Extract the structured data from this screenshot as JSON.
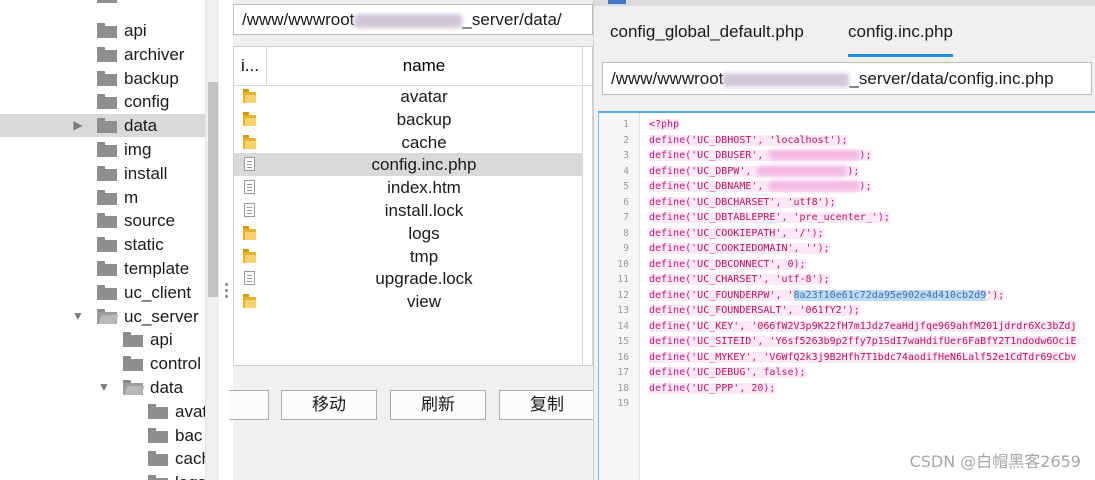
{
  "tree": {
    "items": [
      {
        "label": "api",
        "open": false,
        "arrow": ""
      },
      {
        "label": "archiver",
        "open": false,
        "arrow": ""
      },
      {
        "label": "backup",
        "open": false,
        "arrow": ""
      },
      {
        "label": "config",
        "open": false,
        "arrow": ""
      },
      {
        "label": "data",
        "open": false,
        "arrow": "▶",
        "selected": true
      },
      {
        "label": "img",
        "open": false,
        "arrow": ""
      },
      {
        "label": "install",
        "open": false,
        "arrow": ""
      },
      {
        "label": "m",
        "open": false,
        "arrow": ""
      },
      {
        "label": "source",
        "open": false,
        "arrow": ""
      },
      {
        "label": "static",
        "open": false,
        "arrow": ""
      },
      {
        "label": "template",
        "open": false,
        "arrow": ""
      },
      {
        "label": "uc_client",
        "open": false,
        "arrow": ""
      },
      {
        "label": "uc_server",
        "open": true,
        "arrow": "▼"
      }
    ],
    "uc_server_children": [
      {
        "label": "api"
      },
      {
        "label": "control"
      },
      {
        "label": "data",
        "open": true,
        "arrow": "▼"
      }
    ],
    "data_children": [
      {
        "label": "avat"
      },
      {
        "label": "bac"
      },
      {
        "label": "cach"
      },
      {
        "label": "logs"
      }
    ]
  },
  "mid": {
    "path_prefix": "/www/wwwroot",
    "path_suffix": "_server/data/",
    "columns": [
      "i...",
      "name"
    ],
    "files": [
      {
        "name": "avatar",
        "type": "folder"
      },
      {
        "name": "backup",
        "type": "folder"
      },
      {
        "name": "cache",
        "type": "folder"
      },
      {
        "name": "config.inc.php",
        "type": "file",
        "selected": true
      },
      {
        "name": "index.htm",
        "type": "file"
      },
      {
        "name": "install.lock",
        "type": "file"
      },
      {
        "name": "logs",
        "type": "folder"
      },
      {
        "name": "tmp",
        "type": "folder"
      },
      {
        "name": "upgrade.lock",
        "type": "file"
      },
      {
        "name": "view",
        "type": "folder"
      }
    ],
    "buttons": [
      "移动",
      "刷新",
      "复制"
    ]
  },
  "editor": {
    "tabs": [
      "config_global_default.php",
      "config.inc.php"
    ],
    "active_tab": 1,
    "path_prefix": "/www/wwwroot",
    "path_suffix": "_server/data/config.inc.php",
    "lines": [
      {
        "n": "1",
        "code": "<?php"
      },
      {
        "n": "2",
        "key": "UC_DBHOST",
        "val": "'localhost'"
      },
      {
        "n": "3",
        "key": "UC_DBUSER",
        "val": "",
        "redacted": true
      },
      {
        "n": "4",
        "key": "UC_DBPW",
        "val": "",
        "redacted": true
      },
      {
        "n": "5",
        "key": "UC_DBNAME",
        "val": "",
        "redacted": true
      },
      {
        "n": "6",
        "key": "UC_DBCHARSET",
        "val": "'utf8'"
      },
      {
        "n": "7",
        "key": "UC_DBTABLEPRE",
        "val": "'pre_ucenter_'"
      },
      {
        "n": "8",
        "key": "UC_COOKIEPATH",
        "val": "'/'"
      },
      {
        "n": "9",
        "key": "UC_COOKIEDOMAIN",
        "val": "''"
      },
      {
        "n": "10",
        "key": "UC_DBCONNECT",
        "val": "0"
      },
      {
        "n": "11",
        "key": "UC_CHARSET",
        "val": "'utf-8'"
      },
      {
        "n": "12",
        "key": "UC_FOUNDERPW",
        "val": "8a23f10e61c72da95e902e4d410cb2d9",
        "highlight": true
      },
      {
        "n": "13",
        "key": "UC_FOUNDERSALT",
        "val": "'061fY2'"
      },
      {
        "n": "14",
        "key": "UC_KEY",
        "val": "'066fW2V3p9K22fH7m1Jdz7eaHdjfqe969ahfM201jdrdr6Xc3bZdj"
      },
      {
        "n": "15",
        "key": "UC_SITEID",
        "val": "'Y6sf5263b9p2ffy7p1SdI7waHdifUer6FaBfY2T1ndodw6OciE"
      },
      {
        "n": "16",
        "key": "UC_MYKEY",
        "val": "'V6WfQ2k3j9B2Hfh7T1bdc74aodifHeN6Lalf52e1CdTdr69cCbv"
      },
      {
        "n": "17",
        "key": "UC_DEBUG",
        "val": "false"
      },
      {
        "n": "18",
        "key": "UC_PPP",
        "val": "20"
      },
      {
        "n": "19",
        "code": ""
      }
    ]
  },
  "watermark": "CSDN @白帽黑客2659"
}
